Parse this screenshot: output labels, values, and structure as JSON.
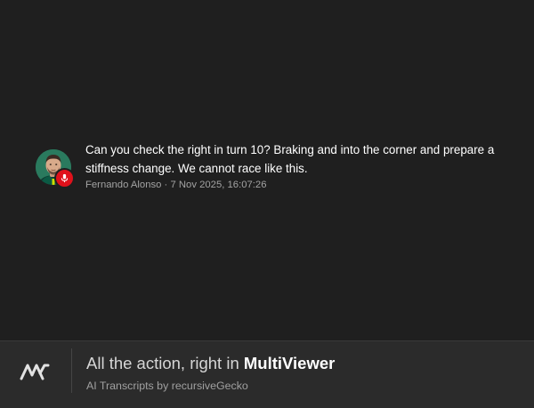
{
  "message": {
    "text": "Can you check the right in turn 10? Braking and into the corner and prepare a stiffness change. We cannot race like this.",
    "author": "Fernando Alonso",
    "separator": " · ",
    "timestamp": "7 Nov 2025, 16:07:26",
    "avatar_icon": "driver-avatar",
    "badge_icon": "microphone-icon",
    "badge_color": "#e0111b",
    "avatar_bg_color": "#2a7a5e"
  },
  "footer": {
    "logo_icon": "multiviewer-logo",
    "tagline_prefix": "All the action, right in ",
    "tagline_brand": "MultiViewer",
    "credit": "AI Transcripts by recursiveGecko"
  },
  "colors": {
    "background": "#1f1f1f",
    "footer_background": "#2b2b2b",
    "text_primary": "#ffffff",
    "text_secondary": "#a3a3a3"
  }
}
